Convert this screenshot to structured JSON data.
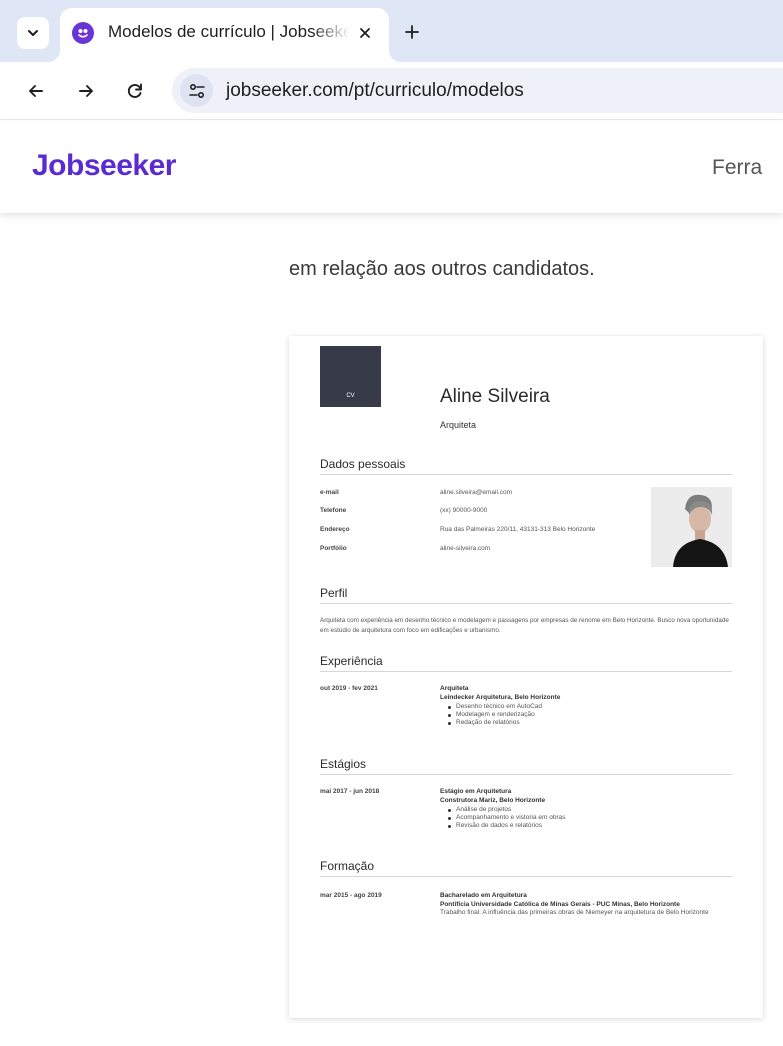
{
  "browser": {
    "tab": {
      "title": "Modelos de currículo | Jobseeker"
    },
    "url": "jobseeker.com/pt/curriculo/modelos",
    "icons": {
      "tab_search": "chevron-down-icon",
      "close": "close-icon",
      "new_tab": "plus-icon",
      "back": "arrow-left-icon",
      "forward": "arrow-right-icon",
      "reload": "reload-icon",
      "site_info": "tune-icon"
    }
  },
  "site": {
    "logo": "Jobseeker",
    "nav_item": "Ferra",
    "brand_color": "#5b2bd1"
  },
  "page": {
    "intro": "em relação aos outros candidatos."
  },
  "cv": {
    "logo_text": "CV",
    "name": "Aline Silveira",
    "role": "Arquiteta",
    "personal": {
      "title": "Dados pessoais",
      "rows": [
        {
          "label": "e-mail",
          "value": "aline.silveira@email.com"
        },
        {
          "label": "Telefone",
          "value": "(xx) 90000-9000"
        },
        {
          "label": "Endereço",
          "value": "Rua das Palmeiras 220/11, 43131-313 Belo Horizonte"
        },
        {
          "label": "Portfólio",
          "value": "aline-silveira.com"
        }
      ]
    },
    "profile": {
      "title": "Perfil",
      "text": "Arquiteta com experiência em desenho técnico e modelagem e passagens por empresas de renome em Belo Horizonte. Busco nova oportunidade em estúdio de arquitetura com foco em edificações e urbanismo."
    },
    "experience": {
      "title": "Experiência",
      "date": "out 2019 - fev 2021",
      "position": "Arquiteta",
      "org": "Leindecker Arquitetura, Belo Horizonte",
      "bullets": [
        "Desenho técnico em AutoCad",
        "Modelagem e renderização",
        "Redação de relatórios"
      ]
    },
    "internships": {
      "title": "Estágios",
      "date": "mai 2017 - jun 2018",
      "position": "Estágio em Arquitetura",
      "org": "Construtora Mariz, Belo Horizonte",
      "bullets": [
        "Análise de projetos",
        "Acompanhamento e vistoria em obras",
        "Revisão de dados e relatórios"
      ]
    },
    "education": {
      "title": "Formação",
      "date": "mar 2015 - ago 2019",
      "degree": "Bacharelado em Arquitetura",
      "institution": "Pontifícia Universidade Católica de Minas Gerais - PUC Minas, Belo Horizonte",
      "thesis": "Trabalho final: A influência das primeiras obras de Niemeyer na arquitetura de Belo Horizonte"
    }
  }
}
